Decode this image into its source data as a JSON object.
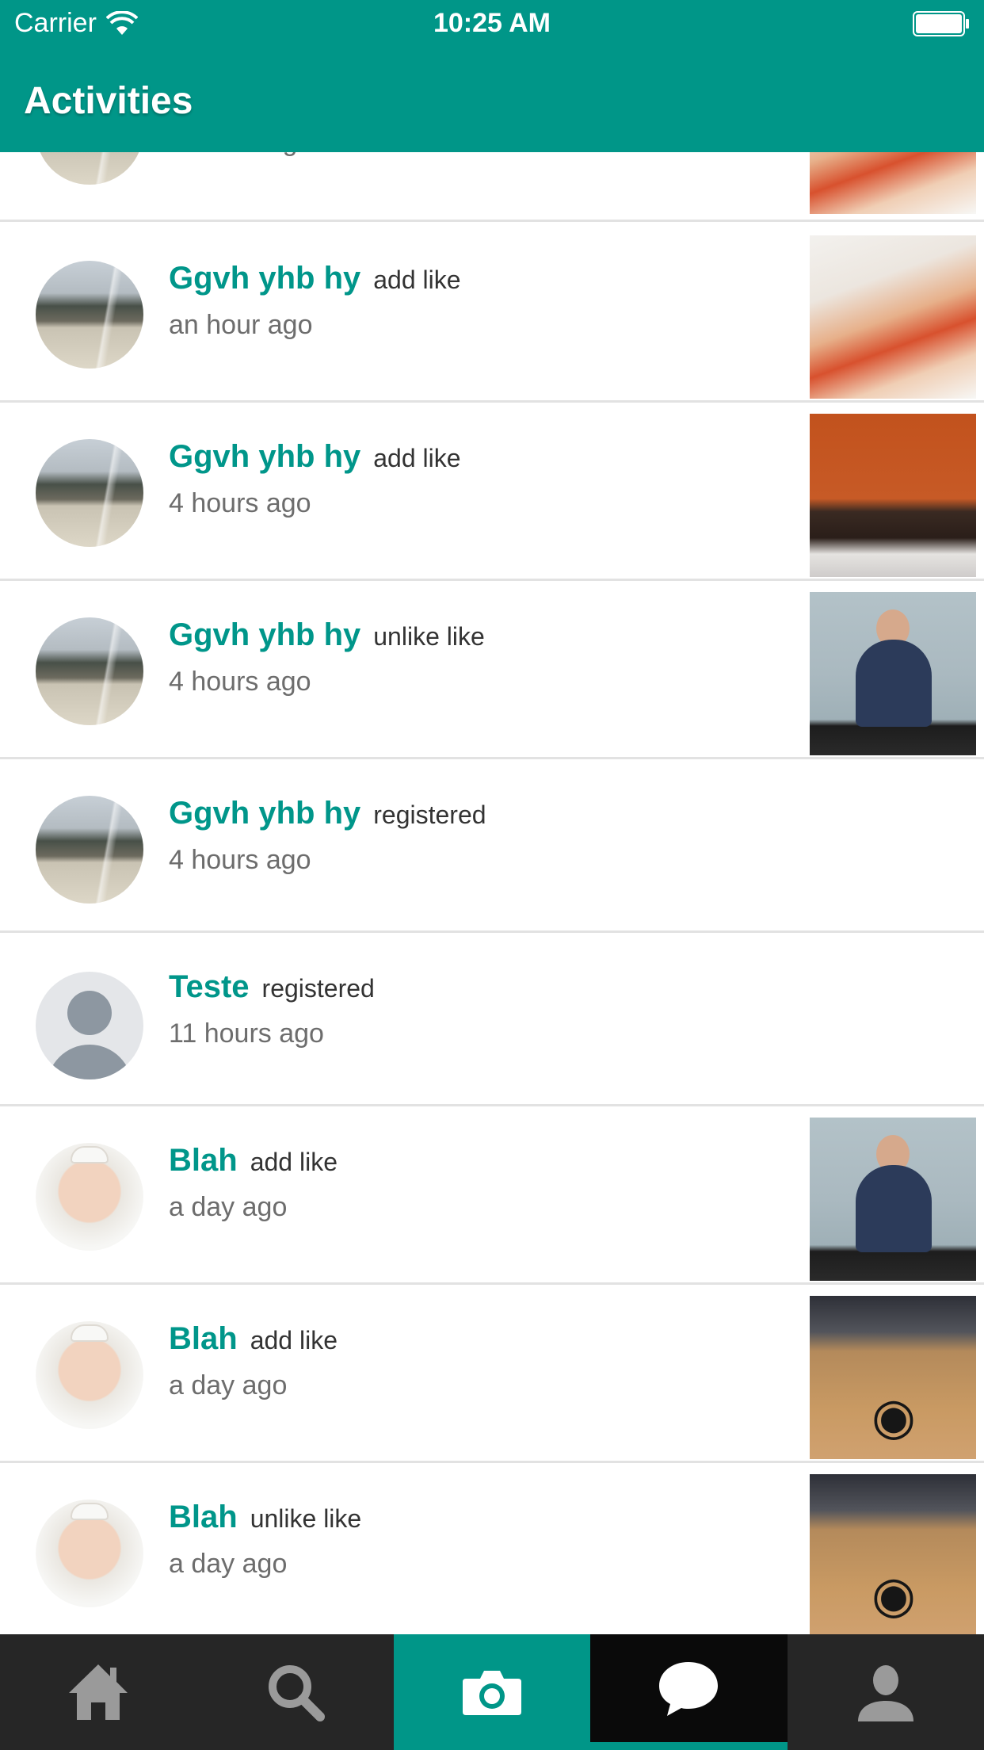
{
  "status_bar": {
    "carrier": "Carrier",
    "time": "10:25 AM"
  },
  "header": {
    "title": "Activities"
  },
  "activities": [
    {
      "name": "",
      "action": "",
      "time": "an hour ago",
      "avatar": "landscape",
      "thumbnail": "girls"
    },
    {
      "name": "Ggvh yhb hy",
      "action": "add like",
      "time": "an hour ago",
      "avatar": "landscape",
      "thumbnail": "girls"
    },
    {
      "name": "Ggvh yhb hy",
      "action": "add like",
      "time": "4 hours ago",
      "avatar": "landscape",
      "thumbnail": "desk"
    },
    {
      "name": "Ggvh yhb hy",
      "action": "unlike like",
      "time": "4 hours ago",
      "avatar": "landscape",
      "thumbnail": "man"
    },
    {
      "name": "Ggvh yhb hy",
      "action": "registered",
      "time": "4 hours ago",
      "avatar": "landscape",
      "thumbnail": ""
    },
    {
      "name": "Teste",
      "action": "registered",
      "time": "11 hours ago",
      "avatar": "placeholder",
      "thumbnail": ""
    },
    {
      "name": "Blah",
      "action": "add like",
      "time": "a day ago",
      "avatar": "portrait",
      "thumbnail": "man"
    },
    {
      "name": "Blah",
      "action": "add like",
      "time": "a day ago",
      "avatar": "portrait",
      "thumbnail": "apple"
    },
    {
      "name": "Blah",
      "action": "unlike like",
      "time": "a day ago",
      "avatar": "portrait",
      "thumbnail": "apple"
    }
  ],
  "tab_bar": {
    "tabs": [
      {
        "icon": "home-icon"
      },
      {
        "icon": "search-icon"
      },
      {
        "icon": "camera-icon"
      },
      {
        "icon": "chat-bubble-icon",
        "selected": true
      },
      {
        "icon": "profile-icon"
      }
    ]
  },
  "colors": {
    "accent": "#009688",
    "tab_bar": "#262626",
    "name_text": "#00968a"
  }
}
